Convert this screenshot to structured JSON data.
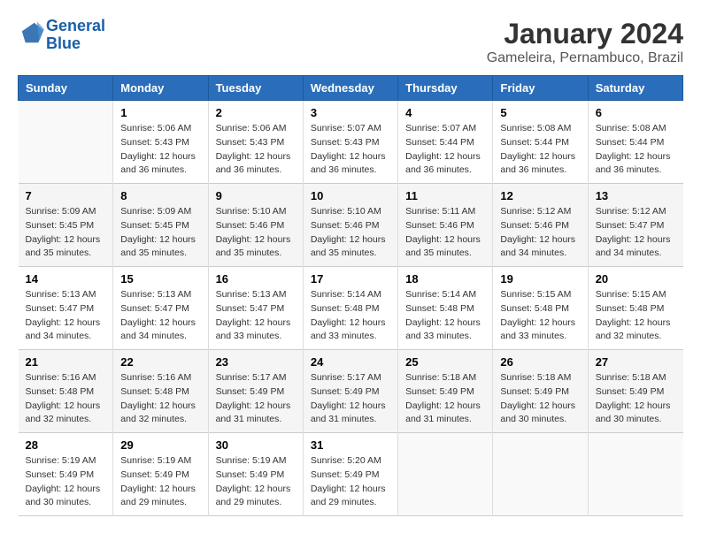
{
  "header": {
    "logo_line1": "General",
    "logo_line2": "Blue",
    "title": "January 2024",
    "subtitle": "Gameleira, Pernambuco, Brazil"
  },
  "columns": [
    "Sunday",
    "Monday",
    "Tuesday",
    "Wednesday",
    "Thursday",
    "Friday",
    "Saturday"
  ],
  "weeks": [
    [
      {
        "day": "",
        "info": ""
      },
      {
        "day": "1",
        "info": "Sunrise: 5:06 AM\nSunset: 5:43 PM\nDaylight: 12 hours\nand 36 minutes."
      },
      {
        "day": "2",
        "info": "Sunrise: 5:06 AM\nSunset: 5:43 PM\nDaylight: 12 hours\nand 36 minutes."
      },
      {
        "day": "3",
        "info": "Sunrise: 5:07 AM\nSunset: 5:43 PM\nDaylight: 12 hours\nand 36 minutes."
      },
      {
        "day": "4",
        "info": "Sunrise: 5:07 AM\nSunset: 5:44 PM\nDaylight: 12 hours\nand 36 minutes."
      },
      {
        "day": "5",
        "info": "Sunrise: 5:08 AM\nSunset: 5:44 PM\nDaylight: 12 hours\nand 36 minutes."
      },
      {
        "day": "6",
        "info": "Sunrise: 5:08 AM\nSunset: 5:44 PM\nDaylight: 12 hours\nand 36 minutes."
      }
    ],
    [
      {
        "day": "7",
        "info": "Sunrise: 5:09 AM\nSunset: 5:45 PM\nDaylight: 12 hours\nand 35 minutes."
      },
      {
        "day": "8",
        "info": "Sunrise: 5:09 AM\nSunset: 5:45 PM\nDaylight: 12 hours\nand 35 minutes."
      },
      {
        "day": "9",
        "info": "Sunrise: 5:10 AM\nSunset: 5:46 PM\nDaylight: 12 hours\nand 35 minutes."
      },
      {
        "day": "10",
        "info": "Sunrise: 5:10 AM\nSunset: 5:46 PM\nDaylight: 12 hours\nand 35 minutes."
      },
      {
        "day": "11",
        "info": "Sunrise: 5:11 AM\nSunset: 5:46 PM\nDaylight: 12 hours\nand 35 minutes."
      },
      {
        "day": "12",
        "info": "Sunrise: 5:12 AM\nSunset: 5:46 PM\nDaylight: 12 hours\nand 34 minutes."
      },
      {
        "day": "13",
        "info": "Sunrise: 5:12 AM\nSunset: 5:47 PM\nDaylight: 12 hours\nand 34 minutes."
      }
    ],
    [
      {
        "day": "14",
        "info": "Sunrise: 5:13 AM\nSunset: 5:47 PM\nDaylight: 12 hours\nand 34 minutes."
      },
      {
        "day": "15",
        "info": "Sunrise: 5:13 AM\nSunset: 5:47 PM\nDaylight: 12 hours\nand 34 minutes."
      },
      {
        "day": "16",
        "info": "Sunrise: 5:13 AM\nSunset: 5:47 PM\nDaylight: 12 hours\nand 33 minutes."
      },
      {
        "day": "17",
        "info": "Sunrise: 5:14 AM\nSunset: 5:48 PM\nDaylight: 12 hours\nand 33 minutes."
      },
      {
        "day": "18",
        "info": "Sunrise: 5:14 AM\nSunset: 5:48 PM\nDaylight: 12 hours\nand 33 minutes."
      },
      {
        "day": "19",
        "info": "Sunrise: 5:15 AM\nSunset: 5:48 PM\nDaylight: 12 hours\nand 33 minutes."
      },
      {
        "day": "20",
        "info": "Sunrise: 5:15 AM\nSunset: 5:48 PM\nDaylight: 12 hours\nand 32 minutes."
      }
    ],
    [
      {
        "day": "21",
        "info": "Sunrise: 5:16 AM\nSunset: 5:48 PM\nDaylight: 12 hours\nand 32 minutes."
      },
      {
        "day": "22",
        "info": "Sunrise: 5:16 AM\nSunset: 5:48 PM\nDaylight: 12 hours\nand 32 minutes."
      },
      {
        "day": "23",
        "info": "Sunrise: 5:17 AM\nSunset: 5:49 PM\nDaylight: 12 hours\nand 31 minutes."
      },
      {
        "day": "24",
        "info": "Sunrise: 5:17 AM\nSunset: 5:49 PM\nDaylight: 12 hours\nand 31 minutes."
      },
      {
        "day": "25",
        "info": "Sunrise: 5:18 AM\nSunset: 5:49 PM\nDaylight: 12 hours\nand 31 minutes."
      },
      {
        "day": "26",
        "info": "Sunrise: 5:18 AM\nSunset: 5:49 PM\nDaylight: 12 hours\nand 30 minutes."
      },
      {
        "day": "27",
        "info": "Sunrise: 5:18 AM\nSunset: 5:49 PM\nDaylight: 12 hours\nand 30 minutes."
      }
    ],
    [
      {
        "day": "28",
        "info": "Sunrise: 5:19 AM\nSunset: 5:49 PM\nDaylight: 12 hours\nand 30 minutes."
      },
      {
        "day": "29",
        "info": "Sunrise: 5:19 AM\nSunset: 5:49 PM\nDaylight: 12 hours\nand 29 minutes."
      },
      {
        "day": "30",
        "info": "Sunrise: 5:19 AM\nSunset: 5:49 PM\nDaylight: 12 hours\nand 29 minutes."
      },
      {
        "day": "31",
        "info": "Sunrise: 5:20 AM\nSunset: 5:49 PM\nDaylight: 12 hours\nand 29 minutes."
      },
      {
        "day": "",
        "info": ""
      },
      {
        "day": "",
        "info": ""
      },
      {
        "day": "",
        "info": ""
      }
    ]
  ]
}
